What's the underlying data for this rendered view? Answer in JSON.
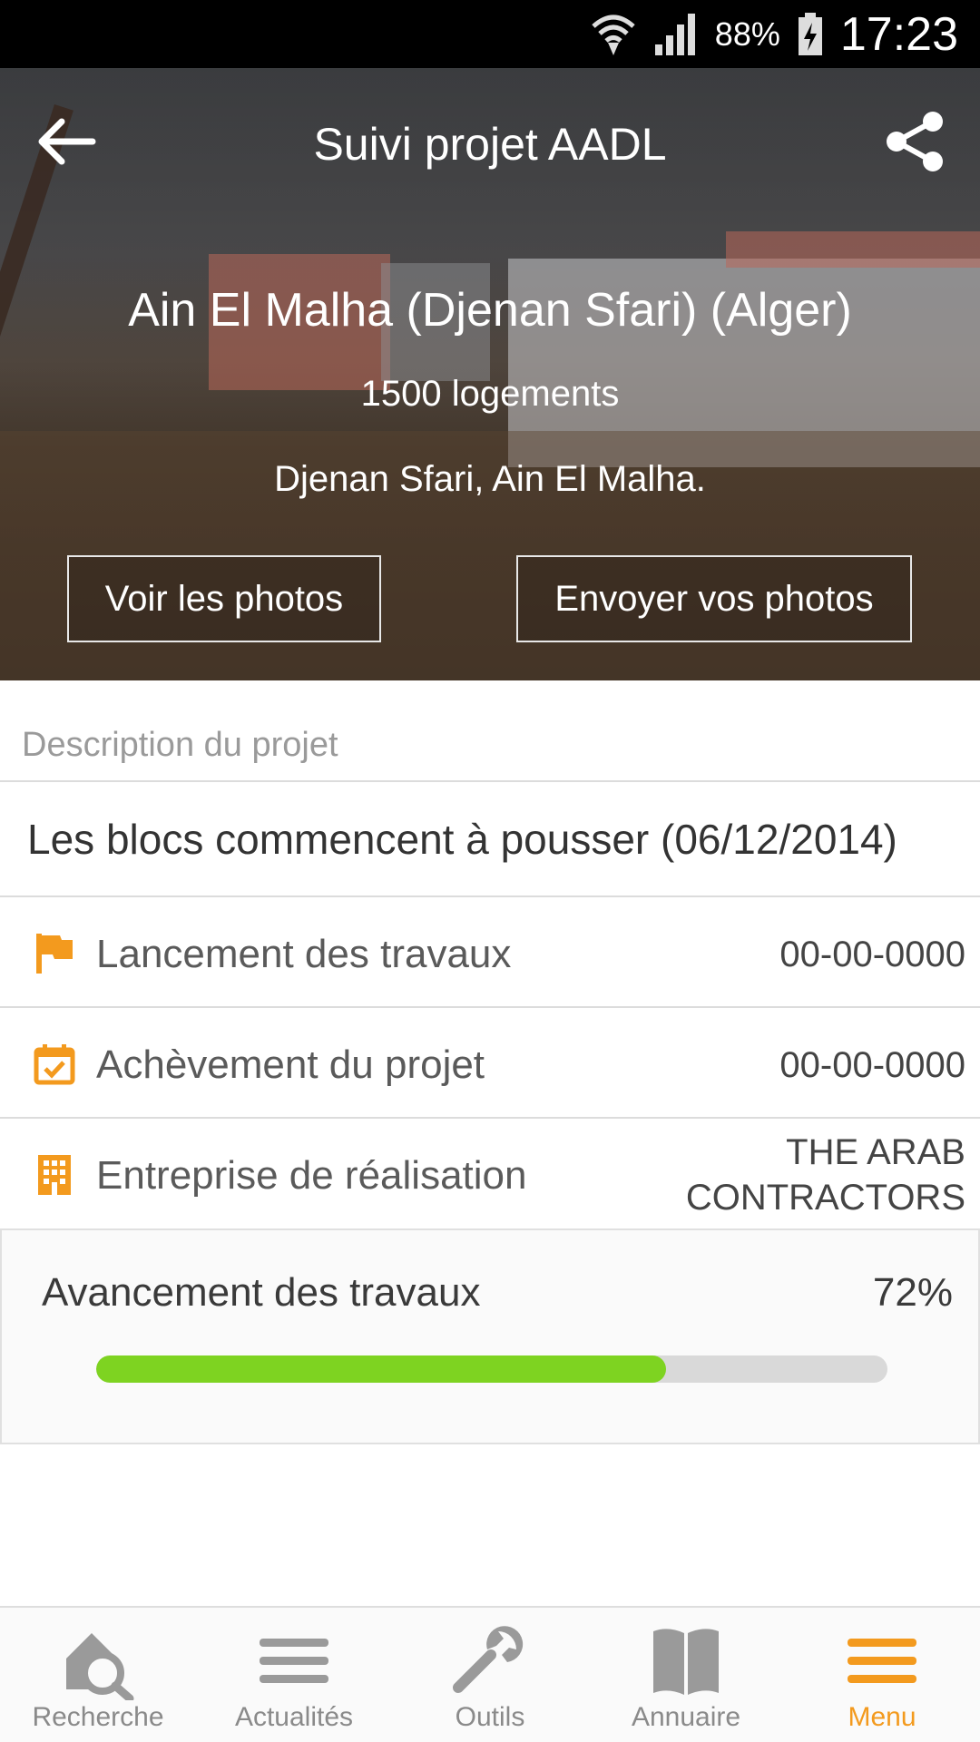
{
  "status_bar": {
    "battery": "88%",
    "time": "17:23"
  },
  "header": {
    "title": "Suivi projet AADL"
  },
  "project": {
    "name": "Ain El Malha (Djenan Sfari) (Alger)",
    "units": "1500 logements",
    "address": "Djenan Sfari, Ain El Malha."
  },
  "actions": {
    "view_photos": "Voir les photos",
    "send_photos": "Envoyer vos photos"
  },
  "description": {
    "section_label": "Description du projet",
    "headline": "Les blocs commencent à pousser (06/12/2014)"
  },
  "details": [
    {
      "icon": "flag-icon",
      "label": "Lancement des travaux",
      "value": "00-00-0000"
    },
    {
      "icon": "calendar-check-icon",
      "label": "Achèvement du projet",
      "value": "00-00-0000"
    },
    {
      "icon": "building-icon",
      "label": "Entreprise de réalisation",
      "value_line1": "THE ARAB",
      "value_line2": "CONTRACTORS"
    }
  ],
  "progress": {
    "label": "Avancement des travaux",
    "value_text": "72%",
    "fraction": 0.72
  },
  "colors": {
    "accent": "#f39a1e",
    "progress": "#7ed321",
    "status_bar": "#000000"
  },
  "bottom_nav": [
    {
      "icon": "home-search-icon",
      "label": "Recherche"
    },
    {
      "icon": "menu-lines-icon",
      "label": "Actualités"
    },
    {
      "icon": "wrench-icon",
      "label": "Outils"
    },
    {
      "icon": "book-icon",
      "label": "Annuaire"
    },
    {
      "icon": "menu-icon",
      "label": "Menu",
      "active": true
    }
  ]
}
